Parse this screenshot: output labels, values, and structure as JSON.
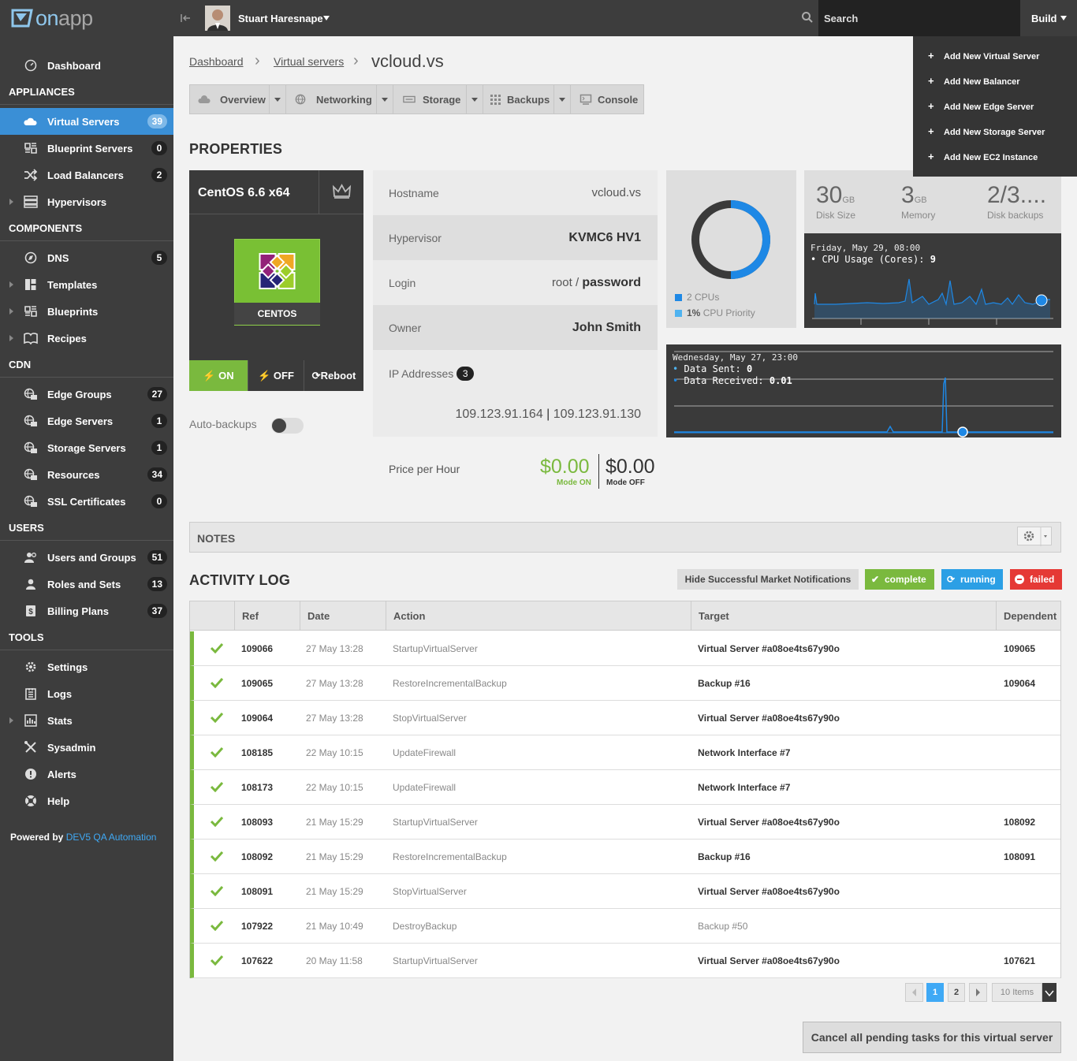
{
  "brand": {
    "logo_on": "on",
    "logo_app": "app"
  },
  "sidebar": {
    "dashboard": "Dashboard",
    "sections": {
      "appliances": "APPLIANCES",
      "components": "COMPONENTS",
      "cdn": "CDN",
      "users": "USERS",
      "tools": "TOOLS"
    },
    "appliances": [
      {
        "label": "Virtual Servers",
        "badge": "39",
        "icon": "cloud-icon"
      },
      {
        "label": "Blueprint Servers",
        "badge": "0",
        "icon": "blueprint-icon"
      },
      {
        "label": "Load Balancers",
        "badge": "2",
        "icon": "shuffle-icon"
      },
      {
        "label": "Hypervisors",
        "badge": "",
        "icon": "server-icon"
      }
    ],
    "components": [
      {
        "label": "DNS",
        "badge": "5",
        "icon": "compass-icon"
      },
      {
        "label": "Templates",
        "badge": "",
        "icon": "templates-icon"
      },
      {
        "label": "Blueprints",
        "badge": "",
        "icon": "blueprint-icon"
      },
      {
        "label": "Recipes",
        "badge": "",
        "icon": "book-icon"
      }
    ],
    "cdn": [
      {
        "label": "Edge Groups",
        "badge": "27",
        "icon": "cdn-icon"
      },
      {
        "label": "Edge Servers",
        "badge": "1",
        "icon": "cdn-icon"
      },
      {
        "label": "Storage Servers",
        "badge": "1",
        "icon": "cdn-icon"
      },
      {
        "label": "Resources",
        "badge": "34",
        "icon": "cdn-icon"
      },
      {
        "label": "SSL Certificates",
        "badge": "0",
        "icon": "cdn-icon"
      }
    ],
    "users": [
      {
        "label": "Users and Groups",
        "badge": "51",
        "icon": "users-icon"
      },
      {
        "label": "Roles and Sets",
        "badge": "13",
        "icon": "user-icon"
      },
      {
        "label": "Billing Plans",
        "badge": "37",
        "icon": "dollar-icon"
      }
    ],
    "tools": [
      {
        "label": "Settings",
        "icon": "gear-icon"
      },
      {
        "label": "Logs",
        "icon": "logs-icon"
      },
      {
        "label": "Stats",
        "icon": "stats-icon"
      },
      {
        "label": "Sysadmin",
        "icon": "tools-icon"
      },
      {
        "label": "Alerts",
        "icon": "alert-icon"
      },
      {
        "label": "Help",
        "icon": "help-icon"
      }
    ],
    "powered_by": "Powered by",
    "powered_name": "DEV5 QA Automation"
  },
  "topbar": {
    "username": "Stuart Haresnape",
    "search_placeholder": "Search",
    "build": "Build",
    "build_menu": [
      "Add New Virtual Server",
      "Add New Balancer",
      "Add New Edge Server",
      "Add New Storage Server",
      "Add New EC2 Instance"
    ]
  },
  "breadcrumb": {
    "items": [
      "Dashboard",
      "Virtual servers"
    ],
    "current": "vcloud.vs"
  },
  "tabs": [
    "Overview",
    "Networking",
    "Storage",
    "Backups",
    "Console"
  ],
  "properties": {
    "title": "PROPERTIES",
    "os_name": "CentOS 6.6 x64",
    "os_label": "CENTOS",
    "power": {
      "on": "ON",
      "off": "OFF",
      "reboot": "Reboot"
    },
    "auto_backups": "Auto-backups",
    "rows": {
      "hostname_k": "Hostname",
      "hostname_v": "vcloud.vs",
      "hypervisor_k": "Hypervisor",
      "hypervisor_v": "KVMC6 HV1",
      "login_k": "Login",
      "login_user": "root",
      "login_sep": "/",
      "login_pass": "password",
      "owner_k": "Owner",
      "owner_v": "John Smith",
      "ip_k": "IP Addresses",
      "ip_count": "3",
      "ip_1": "109.123.91.164",
      "ip_2": "109.123.91.130"
    },
    "price": {
      "label": "Price per Hour",
      "on": "$0.00",
      "on_label": "Mode ON",
      "off": "$0.00",
      "off_label": "Mode OFF"
    },
    "cpu": {
      "cpus": "2 CPUs",
      "priority_value": "1%",
      "priority_label": "CPU Priority",
      "donut_fraction": 0.5,
      "colors": {
        "cpus": "#1e88e5",
        "priority": "#4fb3f0"
      }
    },
    "stats": [
      {
        "value": "30",
        "unit": "GB",
        "label": "Disk Size"
      },
      {
        "value": "3",
        "unit": "GB",
        "label": "Memory"
      },
      {
        "value": "2/3....",
        "unit": "",
        "label": "Disk backups"
      }
    ],
    "cpu_chart": {
      "date": "Friday, May 29, 08:00",
      "series": "CPU Usage (Cores):",
      "value": "9"
    },
    "net_chart": {
      "date": "Wednesday, May 27, 23:00",
      "sent_label": "Data Sent:",
      "sent": "0",
      "recv_label": "Data Received:",
      "recv": "0.01"
    }
  },
  "notes": {
    "title": "NOTES"
  },
  "activity": {
    "title": "ACTIVITY LOG",
    "hide_btn": "Hide Successful Market Notifications",
    "filters": {
      "complete": "complete",
      "running": "running",
      "failed": "failed"
    },
    "columns": [
      "Ref",
      "Date",
      "Action",
      "Target",
      "Dependent"
    ],
    "rows": [
      {
        "ref": "109066",
        "date": "27 May 13:28",
        "action": "StartupVirtualServer",
        "target": "Virtual Server #a08oe4ts67y90o",
        "dependent": "109065"
      },
      {
        "ref": "109065",
        "date": "27 May 13:28",
        "action": "RestoreIncrementalBackup",
        "target": "Backup #16",
        "dependent": "109064"
      },
      {
        "ref": "109064",
        "date": "27 May 13:28",
        "action": "StopVirtualServer",
        "target": "Virtual Server #a08oe4ts67y90o",
        "dependent": ""
      },
      {
        "ref": "108185",
        "date": "22 May 10:15",
        "action": "UpdateFirewall",
        "target": "Network Interface #7",
        "dependent": ""
      },
      {
        "ref": "108173",
        "date": "22 May 10:15",
        "action": "UpdateFirewall",
        "target": "Network Interface #7",
        "dependent": ""
      },
      {
        "ref": "108093",
        "date": "21 May 15:29",
        "action": "StartupVirtualServer",
        "target": "Virtual Server #a08oe4ts67y90o",
        "dependent": "108092"
      },
      {
        "ref": "108092",
        "date": "21 May 15:29",
        "action": "RestoreIncrementalBackup",
        "target": "Backup #16",
        "dependent": "108091"
      },
      {
        "ref": "108091",
        "date": "21 May 15:29",
        "action": "StopVirtualServer",
        "target": "Virtual Server #a08oe4ts67y90o",
        "dependent": ""
      },
      {
        "ref": "107922",
        "date": "21 May 10:49",
        "action": "DestroyBackup",
        "target": "Backup #50",
        "dependent": ""
      },
      {
        "ref": "107622",
        "date": "20 May 11:58",
        "action": "StartupVirtualServer",
        "target": "Virtual Server #a08oe4ts67y90o",
        "dependent": "107621"
      }
    ],
    "pagination": {
      "page1": "1",
      "page2": "2",
      "per_page": "10 Items"
    },
    "cancel_btn": "Cancel all pending tasks for this virtual server"
  }
}
